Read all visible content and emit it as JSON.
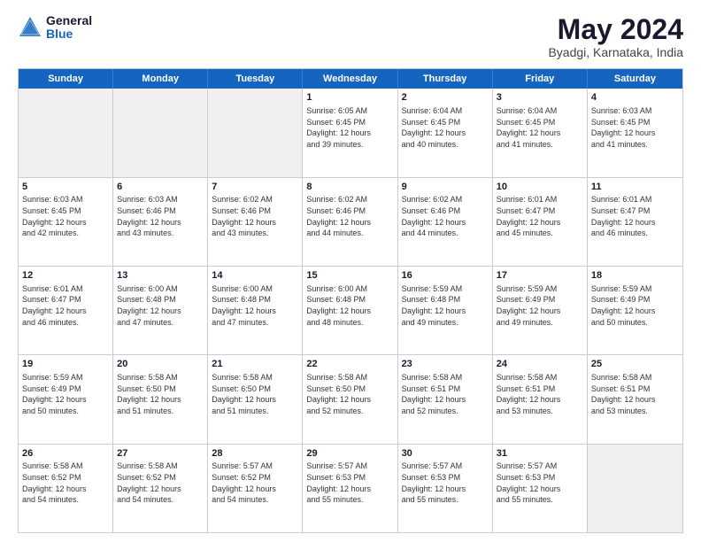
{
  "logo": {
    "general": "General",
    "blue": "Blue"
  },
  "title": "May 2024",
  "location": "Byadgi, Karnataka, India",
  "header_days": [
    "Sunday",
    "Monday",
    "Tuesday",
    "Wednesday",
    "Thursday",
    "Friday",
    "Saturday"
  ],
  "weeks": [
    [
      {
        "day": "",
        "info": "",
        "empty": true
      },
      {
        "day": "",
        "info": "",
        "empty": true
      },
      {
        "day": "",
        "info": "",
        "empty": true
      },
      {
        "day": "1",
        "info": "Sunrise: 6:05 AM\nSunset: 6:45 PM\nDaylight: 12 hours\nand 39 minutes."
      },
      {
        "day": "2",
        "info": "Sunrise: 6:04 AM\nSunset: 6:45 PM\nDaylight: 12 hours\nand 40 minutes."
      },
      {
        "day": "3",
        "info": "Sunrise: 6:04 AM\nSunset: 6:45 PM\nDaylight: 12 hours\nand 41 minutes."
      },
      {
        "day": "4",
        "info": "Sunrise: 6:03 AM\nSunset: 6:45 PM\nDaylight: 12 hours\nand 41 minutes."
      }
    ],
    [
      {
        "day": "5",
        "info": "Sunrise: 6:03 AM\nSunset: 6:45 PM\nDaylight: 12 hours\nand 42 minutes."
      },
      {
        "day": "6",
        "info": "Sunrise: 6:03 AM\nSunset: 6:46 PM\nDaylight: 12 hours\nand 43 minutes."
      },
      {
        "day": "7",
        "info": "Sunrise: 6:02 AM\nSunset: 6:46 PM\nDaylight: 12 hours\nand 43 minutes."
      },
      {
        "day": "8",
        "info": "Sunrise: 6:02 AM\nSunset: 6:46 PM\nDaylight: 12 hours\nand 44 minutes."
      },
      {
        "day": "9",
        "info": "Sunrise: 6:02 AM\nSunset: 6:46 PM\nDaylight: 12 hours\nand 44 minutes."
      },
      {
        "day": "10",
        "info": "Sunrise: 6:01 AM\nSunset: 6:47 PM\nDaylight: 12 hours\nand 45 minutes."
      },
      {
        "day": "11",
        "info": "Sunrise: 6:01 AM\nSunset: 6:47 PM\nDaylight: 12 hours\nand 46 minutes."
      }
    ],
    [
      {
        "day": "12",
        "info": "Sunrise: 6:01 AM\nSunset: 6:47 PM\nDaylight: 12 hours\nand 46 minutes."
      },
      {
        "day": "13",
        "info": "Sunrise: 6:00 AM\nSunset: 6:48 PM\nDaylight: 12 hours\nand 47 minutes."
      },
      {
        "day": "14",
        "info": "Sunrise: 6:00 AM\nSunset: 6:48 PM\nDaylight: 12 hours\nand 47 minutes."
      },
      {
        "day": "15",
        "info": "Sunrise: 6:00 AM\nSunset: 6:48 PM\nDaylight: 12 hours\nand 48 minutes."
      },
      {
        "day": "16",
        "info": "Sunrise: 5:59 AM\nSunset: 6:48 PM\nDaylight: 12 hours\nand 49 minutes."
      },
      {
        "day": "17",
        "info": "Sunrise: 5:59 AM\nSunset: 6:49 PM\nDaylight: 12 hours\nand 49 minutes."
      },
      {
        "day": "18",
        "info": "Sunrise: 5:59 AM\nSunset: 6:49 PM\nDaylight: 12 hours\nand 50 minutes."
      }
    ],
    [
      {
        "day": "19",
        "info": "Sunrise: 5:59 AM\nSunset: 6:49 PM\nDaylight: 12 hours\nand 50 minutes."
      },
      {
        "day": "20",
        "info": "Sunrise: 5:58 AM\nSunset: 6:50 PM\nDaylight: 12 hours\nand 51 minutes."
      },
      {
        "day": "21",
        "info": "Sunrise: 5:58 AM\nSunset: 6:50 PM\nDaylight: 12 hours\nand 51 minutes."
      },
      {
        "day": "22",
        "info": "Sunrise: 5:58 AM\nSunset: 6:50 PM\nDaylight: 12 hours\nand 52 minutes."
      },
      {
        "day": "23",
        "info": "Sunrise: 5:58 AM\nSunset: 6:51 PM\nDaylight: 12 hours\nand 52 minutes."
      },
      {
        "day": "24",
        "info": "Sunrise: 5:58 AM\nSunset: 6:51 PM\nDaylight: 12 hours\nand 53 minutes."
      },
      {
        "day": "25",
        "info": "Sunrise: 5:58 AM\nSunset: 6:51 PM\nDaylight: 12 hours\nand 53 minutes."
      }
    ],
    [
      {
        "day": "26",
        "info": "Sunrise: 5:58 AM\nSunset: 6:52 PM\nDaylight: 12 hours\nand 54 minutes."
      },
      {
        "day": "27",
        "info": "Sunrise: 5:58 AM\nSunset: 6:52 PM\nDaylight: 12 hours\nand 54 minutes."
      },
      {
        "day": "28",
        "info": "Sunrise: 5:57 AM\nSunset: 6:52 PM\nDaylight: 12 hours\nand 54 minutes."
      },
      {
        "day": "29",
        "info": "Sunrise: 5:57 AM\nSunset: 6:53 PM\nDaylight: 12 hours\nand 55 minutes."
      },
      {
        "day": "30",
        "info": "Sunrise: 5:57 AM\nSunset: 6:53 PM\nDaylight: 12 hours\nand 55 minutes."
      },
      {
        "day": "31",
        "info": "Sunrise: 5:57 AM\nSunset: 6:53 PM\nDaylight: 12 hours\nand 55 minutes."
      },
      {
        "day": "",
        "info": "",
        "empty": true
      }
    ]
  ]
}
